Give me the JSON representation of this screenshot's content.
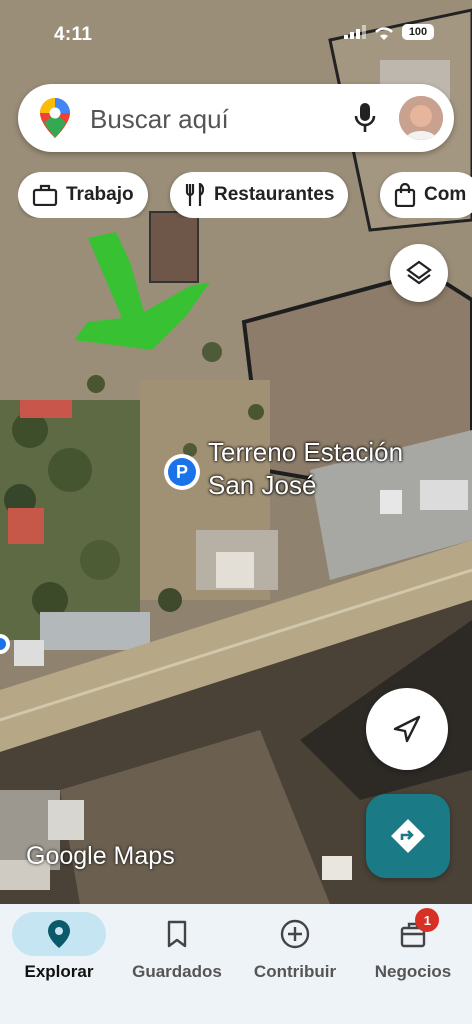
{
  "status_bar": {
    "time": "4:11",
    "battery": "100"
  },
  "search": {
    "placeholder": "Buscar aquí"
  },
  "chips": [
    {
      "label": "Trabajo",
      "icon": "briefcase-icon"
    },
    {
      "label": "Restaurantes",
      "icon": "fork-knife-icon"
    },
    {
      "label": "Com",
      "icon": "shopping-bag-icon"
    }
  ],
  "place": {
    "line1": "Terreno Estación",
    "line2": "San José",
    "marker_letter": "P"
  },
  "watermark": "Google Maps",
  "nav": {
    "items": [
      {
        "label": "Explorar",
        "icon": "location-pin-icon",
        "active": true
      },
      {
        "label": "Guardados",
        "icon": "bookmark-icon"
      },
      {
        "label": "Contribuir",
        "icon": "add-circle-icon"
      },
      {
        "label": "Negocios",
        "icon": "store-icon",
        "badge": "1"
      }
    ]
  },
  "colors": {
    "accent": "#1a73e8",
    "directions_button": "#1a7a85",
    "nav_active": "#c6e5f2",
    "badge": "#d93025",
    "drawn_arrow": "#2ec62a"
  }
}
